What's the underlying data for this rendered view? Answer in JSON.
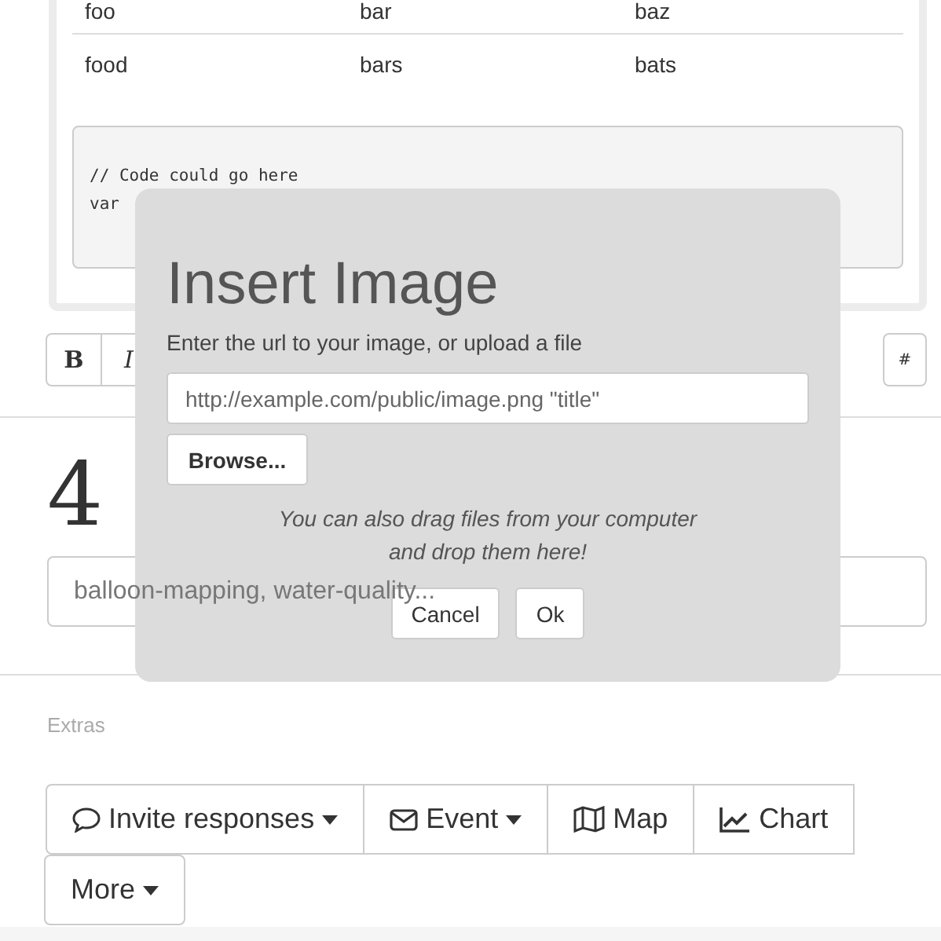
{
  "table": {
    "rows": [
      [
        "foo",
        "bar",
        "baz"
      ],
      [
        "food",
        "bars",
        "bats"
      ]
    ]
  },
  "code": [
    "// Code could go here",
    "var"
  ],
  "toolbar": [
    {
      "label": "B",
      "kind": "bold"
    },
    {
      "label": "I",
      "kind": "italic"
    },
    {
      "label": "#",
      "kind": "plain"
    }
  ],
  "step": "4",
  "tags_field": {
    "placeholder": "balloon-mapping, water-quality..."
  },
  "extras_label": "Extras",
  "extras_buttons": [
    {
      "label": "Invite responses",
      "kind": "comment",
      "caret": true
    },
    {
      "label": "Event",
      "kind": "envelope",
      "caret": true
    },
    {
      "label": "Map",
      "kind": "map",
      "caret": false
    },
    {
      "label": "Chart",
      "kind": "chart",
      "caret": false
    },
    {
      "label": "More",
      "kind": "plain",
      "caret": true
    }
  ],
  "dialog": {
    "title": "Insert Image",
    "label": "Enter the url to your image, or upload a file",
    "url_field": {
      "placeholder": "http://example.com/public/image.png \"title\""
    },
    "browse": "Browse...",
    "hint": [
      "You can also drag files from your computer",
      "and drop them here!"
    ],
    "buttons": [
      "Cancel",
      "Ok"
    ]
  }
}
